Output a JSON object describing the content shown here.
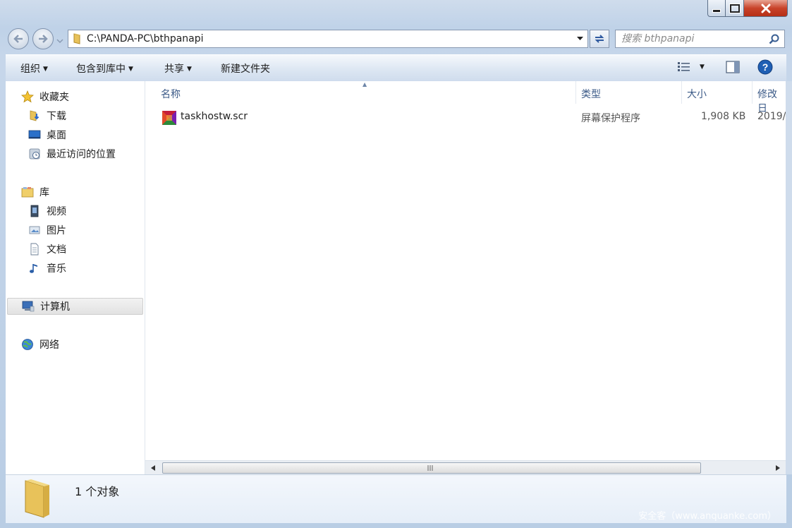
{
  "window": {
    "path": "C:\\PANDA-PC\\bthpanapi",
    "search_placeholder": "搜索 bthpanapi"
  },
  "toolbar": {
    "organize": "组织",
    "include_library": "包含到库中",
    "share": "共享",
    "new_folder": "新建文件夹"
  },
  "nav": {
    "favorites": "收藏夹",
    "downloads": "下载",
    "desktop": "桌面",
    "recent": "最近访问的位置",
    "libraries": "库",
    "videos": "视频",
    "pictures": "图片",
    "documents": "文档",
    "music": "音乐",
    "computer": "计算机",
    "network": "网络"
  },
  "columns": {
    "name": "名称",
    "type": "类型",
    "size": "大小",
    "modified": "修改日"
  },
  "files": [
    {
      "name": "taskhostw.scr",
      "type": "屏幕保护程序",
      "size": "1,908 KB",
      "modified": "2019/"
    }
  ],
  "status": {
    "count": "1 个对象"
  },
  "watermark": "安全客（www.anquanke.com）",
  "colors": {
    "accent": "#3b5a87",
    "help": "#1f5fb4",
    "close": "#c8432a"
  }
}
